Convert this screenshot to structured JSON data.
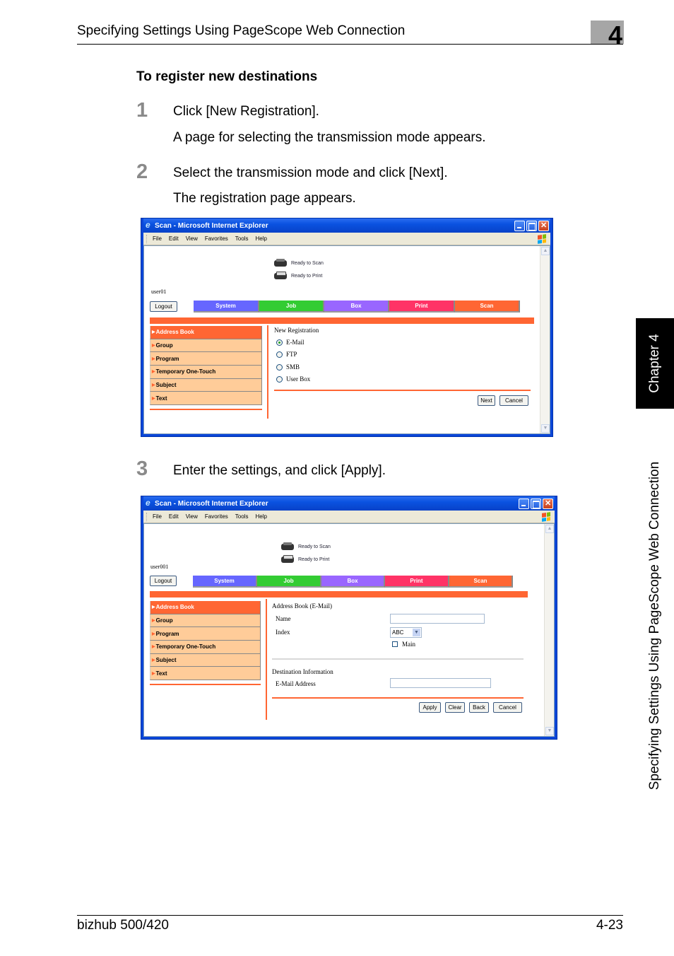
{
  "header": {
    "title": "Specifying Settings Using PageScope Web Connection",
    "chapter_number": "4"
  },
  "section_title": "To register new destinations",
  "steps": [
    {
      "number": "1",
      "text": "Click [New Registration].",
      "result": "A page for selecting the transmission mode appears."
    },
    {
      "number": "2",
      "text": "Select the transmission mode and click [Next].",
      "result": "The registration page appears."
    },
    {
      "number": "3",
      "text": "Enter the settings, and click [Apply]."
    }
  ],
  "side_tab": {
    "chapter": "Chapter 4",
    "section": "Specifying Settings Using PageScope Web Connection"
  },
  "footer": {
    "product": "bizhub 500/420",
    "page": "4-23"
  },
  "colors": {
    "orange": "#ff6633",
    "menu_item": "#ffcc99",
    "tab_system": "#6666ff",
    "tab_job": "#33cc33",
    "tab_box": "#9966ff",
    "tab_print": "#ff3366",
    "tab_scan": "#ff6633"
  },
  "browser": {
    "title": "Scan - Microsoft Internet Explorer",
    "menu": [
      "File",
      "Edit",
      "View",
      "Favorites",
      "Tools",
      "Help"
    ],
    "status_scan": "Ready to Scan",
    "status_print": "Ready to Print",
    "logout": "Logout",
    "tabs": [
      "System",
      "Job",
      "Box",
      "Print",
      "Scan"
    ],
    "left_menu": [
      "Address Book",
      "Group",
      "Program",
      "Temporary One-Touch",
      "Subject",
      "Text"
    ]
  },
  "screen1": {
    "user": "user01",
    "heading": "New Registration",
    "options": [
      {
        "label": "E-Mail",
        "selected": true
      },
      {
        "label": "FTP",
        "selected": false
      },
      {
        "label": "SMB",
        "selected": false
      },
      {
        "label": "User Box",
        "selected": false
      }
    ],
    "next": "Next",
    "cancel": "Cancel"
  },
  "screen2": {
    "user": "user001",
    "heading": "Address Book (E-Mail)",
    "name_label": "Name",
    "name_value": "",
    "index_label": "Index",
    "index_value": "ABC",
    "main_label": "Main",
    "main_checked": false,
    "dest_heading": "Destination Information",
    "email_label": "E-Mail Address",
    "email_value": "",
    "apply": "Apply",
    "clear": "Clear",
    "back": "Back",
    "cancel": "Cancel"
  }
}
